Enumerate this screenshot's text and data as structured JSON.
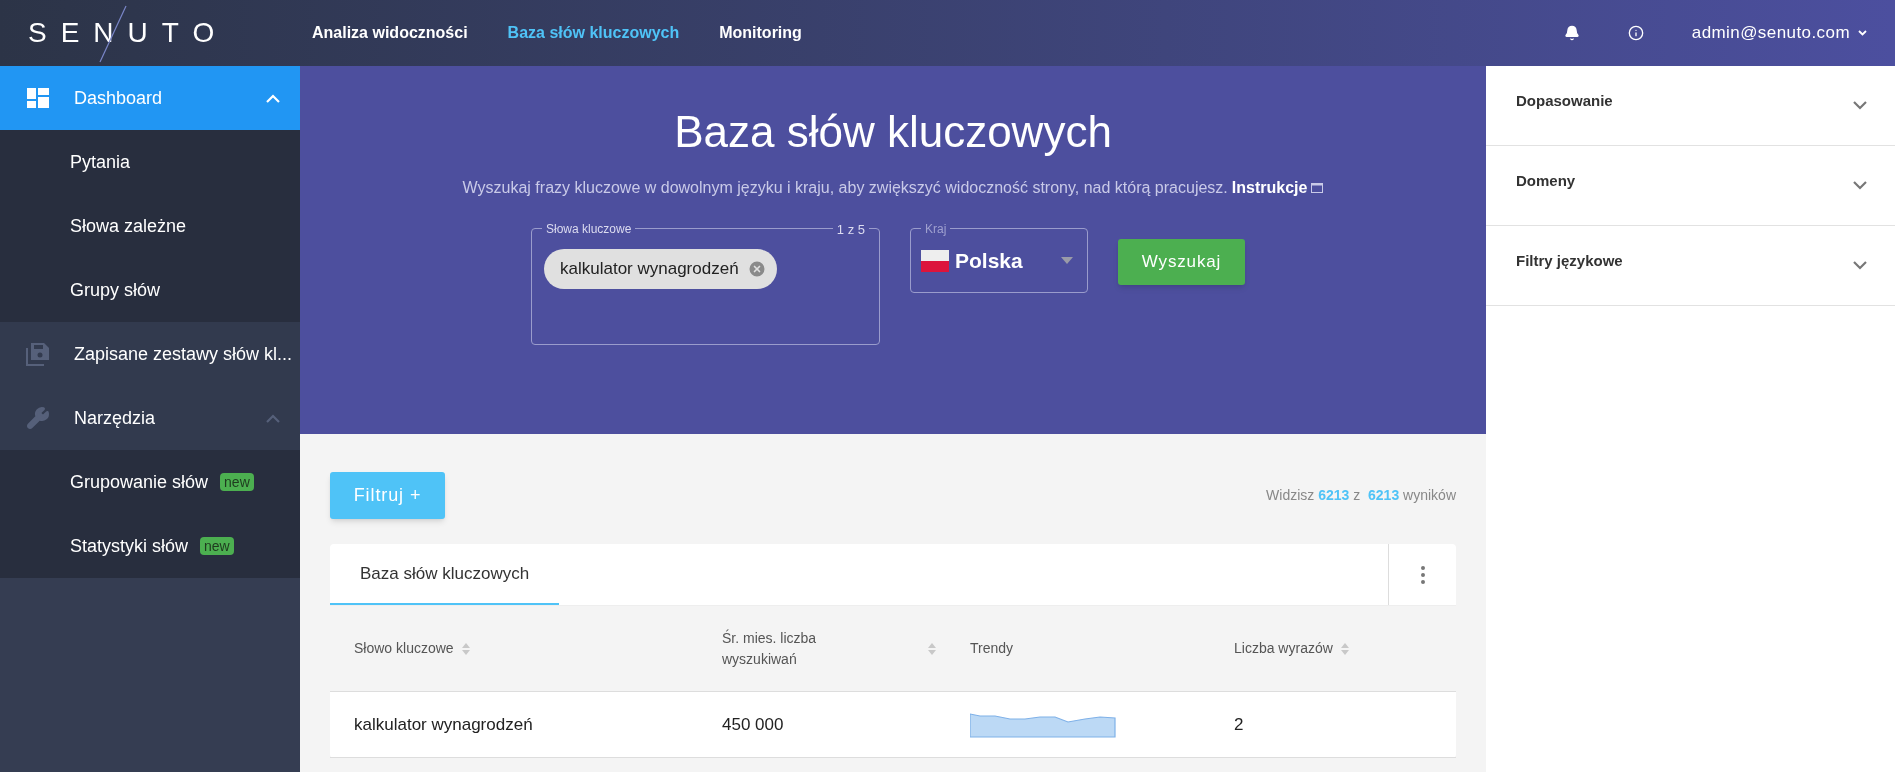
{
  "header": {
    "logo": "SENUTO",
    "nav": [
      {
        "label": "Analiza widoczności",
        "selected": false
      },
      {
        "label": "Baza słów kluczowych",
        "selected": true
      },
      {
        "label": "Monitoring",
        "selected": false
      }
    ],
    "user": "admin@senuto.com"
  },
  "sidebar": {
    "items": [
      {
        "label": "Dashboard",
        "selected": true,
        "expanded": true,
        "children": [
          {
            "label": "Pytania"
          },
          {
            "label": "Słowa zależne"
          },
          {
            "label": "Grupy słów"
          }
        ]
      },
      {
        "label": "Zapisane zestawy słów kl...",
        "selected": false
      },
      {
        "label": "Narzędzia",
        "selected": false,
        "expanded": true,
        "children": [
          {
            "label": "Grupowanie słów",
            "badge": "new"
          },
          {
            "label": "Statystyki słów",
            "badge": "new"
          }
        ]
      }
    ]
  },
  "hero": {
    "title": "Baza słów kluczowych",
    "subtitle": "Wyszukaj frazy kluczowe w dowolnym języku i kraju, aby zwiększyć widoczność strony, nad którą pracujesz.",
    "link": "Instrukcje",
    "keywords_field": {
      "label": "Słowa kluczowe",
      "counter": "1 z 5",
      "chips": [
        "kalkulator wynagrodzeń"
      ]
    },
    "country_field": {
      "label": "Kraj",
      "value": "Polska"
    },
    "search_button": "Wyszukaj"
  },
  "filter_button": "Filtruj +",
  "results": "Widzisz **6213** z  **6213** wyników",
  "table": {
    "tabs": [
      {
        "label": "Baza słów kluczowych",
        "selected": true
      }
    ],
    "columns": [
      {
        "label": "Słowo kluczowe",
        "sortable": true
      },
      {
        "label": "Śr. mies. liczba wyszukiwań",
        "sortable": true
      },
      {
        "label": "Trendy",
        "sortable": false
      },
      {
        "label": "Liczba wyrazów",
        "sortable": true
      }
    ],
    "rows": [
      {
        "keyword": "kalkulator wynagrodzeń",
        "volume": "450 000",
        "words": "2"
      }
    ]
  },
  "filters_panel": [
    {
      "label": "Dopasowanie",
      "expanded": false
    },
    {
      "label": "Domeny",
      "expanded": false
    },
    {
      "label": "Filtry językowe",
      "expanded": false
    }
  ]
}
